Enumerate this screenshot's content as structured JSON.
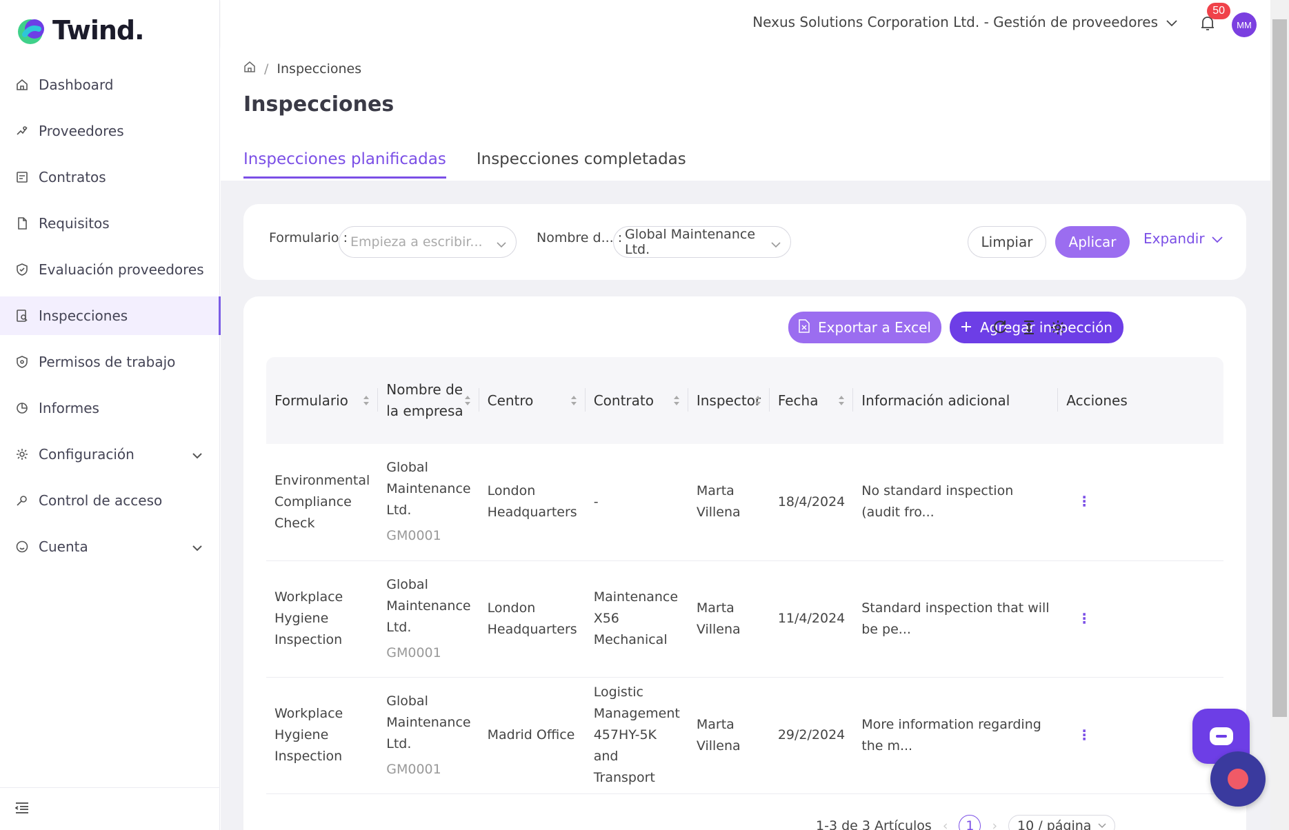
{
  "app": {
    "logo_text": "Twind."
  },
  "sidebar": {
    "items": [
      {
        "label": "Dashboard",
        "icon": "home-icon"
      },
      {
        "label": "Proveedores",
        "icon": "handshake-icon"
      },
      {
        "label": "Contratos",
        "icon": "contract-icon"
      },
      {
        "label": "Requisitos",
        "icon": "file-icon"
      },
      {
        "label": "Evaluación proveedores",
        "icon": "shield-check-icon"
      },
      {
        "label": "Inspecciones",
        "icon": "inspection-icon",
        "active": true
      },
      {
        "label": "Permisos de trabajo",
        "icon": "shield-icon"
      },
      {
        "label": "Informes",
        "icon": "pie-chart-icon"
      },
      {
        "label": "Configuración",
        "icon": "gear-icon",
        "expandable": true
      },
      {
        "label": "Control de acceso",
        "icon": "key-icon"
      },
      {
        "label": "Cuenta",
        "icon": "smile-icon",
        "expandable": true
      }
    ]
  },
  "topbar": {
    "org": "Nexus Solutions Corporation Ltd. - Gestión de proveedores",
    "notifications": "50",
    "avatar": "MM"
  },
  "breadcrumb": {
    "current": "Inspecciones"
  },
  "page": {
    "title": "Inspecciones"
  },
  "tabs": [
    {
      "label": "Inspecciones planificadas",
      "active": true
    },
    {
      "label": "Inspecciones completadas",
      "active": false
    }
  ],
  "filters": {
    "form_label": "Formulario :",
    "form_placeholder": "Empieza a escribir...",
    "company_label": "Nombre d... :",
    "company_value": "Global Maintenance Ltd.",
    "clear": "Limpiar",
    "apply": "Aplicar",
    "expand": "Expandir"
  },
  "toolbar": {
    "export": "Exportar a Excel",
    "add": "Agregar inspección"
  },
  "table": {
    "headers": [
      "Formulario",
      "Nombre de la empresa",
      "Centro",
      "Contrato",
      "Inspector",
      "Fecha",
      "Información adicional",
      "Acciones"
    ],
    "rows": [
      {
        "form": "Environmental Compliance Check",
        "company": "Global Maintenance Ltd.",
        "code": "GM0001",
        "center": "London Headquarters",
        "contract": "-",
        "inspector": "Marta Villena",
        "date": "18/4/2024",
        "info": "No standard inspection (audit fro..."
      },
      {
        "form": "Workplace Hygiene Inspection",
        "company": "Global Maintenance Ltd.",
        "code": "GM0001",
        "center": "London Headquarters",
        "contract": "Maintenance X56 Mechanical",
        "inspector": "Marta Villena",
        "date": "11/4/2024",
        "info": "Standard inspection that will be pe..."
      },
      {
        "form": "Workplace Hygiene Inspection",
        "company": "Global Maintenance Ltd.",
        "code": "GM0001",
        "center": "Madrid Office",
        "contract": "Logistic Management 457HY-5K and Transport",
        "inspector": "Marta Villena",
        "date": "29/2/2024",
        "info": "More information regarding the m..."
      }
    ]
  },
  "pagination": {
    "summary": "1-3 de 3 Artículos",
    "page": "1",
    "page_size": "10 / página"
  },
  "colors": {
    "primary": "#6d3ee6",
    "primary_light": "#9b6df0",
    "badge": "#f0424a"
  }
}
